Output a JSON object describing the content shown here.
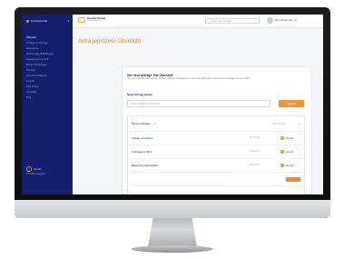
{
  "sidebar": {
    "brand": "Kundenportal",
    "items": [
      {
        "label": "Übersicht",
        "active": true
      },
      {
        "label": "Anfragen & Verträge",
        "active": false
      },
      {
        "label": "Dokumente",
        "active": false
      },
      {
        "label": "Rechnungen & Zahlungen",
        "active": false
      },
      {
        "label": "Einstellungen & Profil",
        "active": false
      },
      {
        "label": "Benachrichtigungen",
        "active": false
      },
      {
        "label": "Postfach",
        "active": false
      },
      {
        "label": "Termine & Kalender",
        "active": false
      },
      {
        "label": "Kontakt",
        "active": false
      },
      {
        "label": "Hilfe & FAQ",
        "active": false
      },
      {
        "label": "Abmelden",
        "active": false
      },
      {
        "label": "FAQ",
        "active": false
      }
    ],
    "footer_title": "Kanzlei",
    "footer_sub": "Kontakt & Support"
  },
  "header": {
    "logo_name": "Kanzlei Portal",
    "logo_sub": "Mandantenportal",
    "search_placeholder": "Suche nach Anfragen",
    "user_name": "Max Mustermann"
  },
  "main": {
    "page_title": "Anfrageprozess Übersicht",
    "card_heading": "Ihre neue Anfrage: Ihre Übersicht",
    "card_text": "Hier sehen Sie alle Informationen zu Ihrem aktuellen Anfrageprozess sowie den Status Ihrer eingereichten Unterlagen auf einen Blick.",
    "label": "Neue Anfrage starten",
    "input_placeholder": "Geben Sie Ihren Namen ein",
    "button_label": "Senden",
    "table": {
      "header": "Meine Anfragen",
      "filter_label": "Alle anzeigen",
      "rows": [
        {
          "title": "Anfrage einreichen",
          "date": "01.03.2024",
          "status": "Erledigt",
          "status_color": "#8cc63f"
        },
        {
          "title": "Unterlagen prüfen",
          "date": "03.03.2024",
          "status": "Erledigt",
          "status_color": "#8cc63f"
        },
        {
          "title": "Bewertung abschließen",
          "date": "05.03.2024",
          "status": "Erledigt",
          "status_color": "#8cc63f"
        }
      ]
    }
  },
  "colors": {
    "accent": "#f08a24",
    "sidebar": "#14206b",
    "status_ok": "#8cc63f"
  }
}
